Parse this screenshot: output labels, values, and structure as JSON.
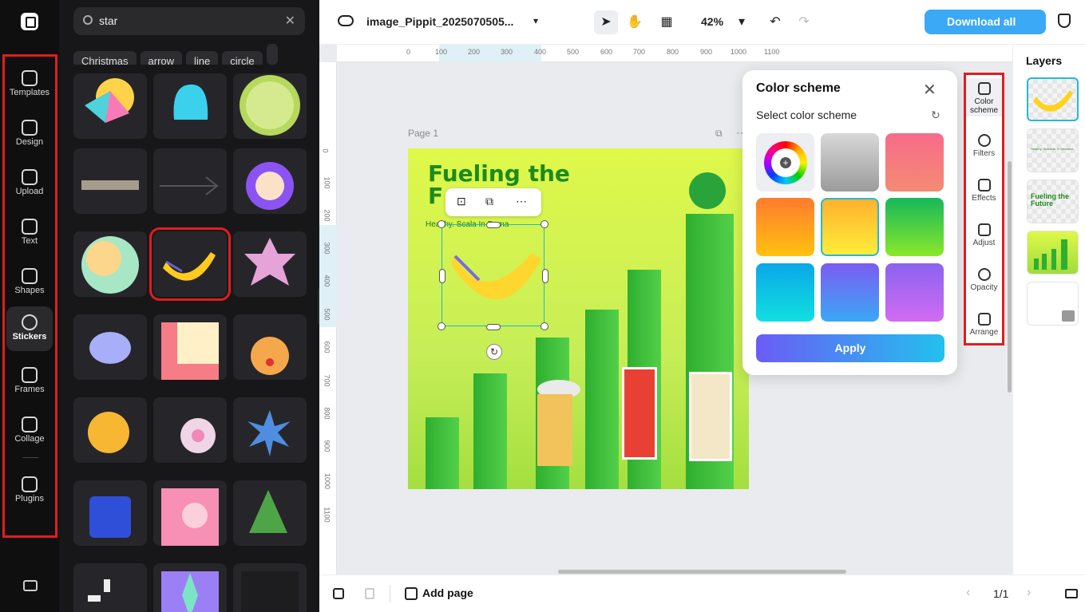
{
  "nav": {
    "items": [
      {
        "label": "Templates",
        "icon": "templates-icon"
      },
      {
        "label": "Design",
        "icon": "design-icon"
      },
      {
        "label": "Upload",
        "icon": "upload-icon"
      },
      {
        "label": "Text",
        "icon": "text-icon"
      },
      {
        "label": "Shapes",
        "icon": "shapes-icon"
      },
      {
        "label": "Stickers",
        "icon": "stickers-icon",
        "active": true
      },
      {
        "label": "Frames",
        "icon": "frames-icon"
      },
      {
        "label": "Collage",
        "icon": "collage-icon"
      },
      {
        "label": "Plugins",
        "icon": "plugins-icon"
      }
    ]
  },
  "search": {
    "value": "star"
  },
  "chips": [
    "Christmas",
    "arrow",
    "line",
    "circle"
  ],
  "topbar": {
    "filename": "image_Pippit_2025070505...",
    "zoom": "42%",
    "download_label": "Download all"
  },
  "ruler": {
    "top": [
      "0",
      "100",
      "200",
      "300",
      "400",
      "500",
      "600",
      "700",
      "800",
      "900",
      "1000",
      "1100"
    ],
    "left": [
      "0",
      "100",
      "200",
      "300",
      "400",
      "500",
      "600",
      "700",
      "800",
      "900",
      "1000",
      "1100"
    ]
  },
  "canvas": {
    "page_label": "Page 1",
    "title_line1": "Fueling the",
    "title_line2": "F",
    "subtitle": "Healthy. Scala In Dema"
  },
  "color_scheme": {
    "title": "Color scheme",
    "subtitle": "Select color scheme",
    "apply_label": "Apply",
    "swatches": [
      {
        "name": "custom",
        "gradient": "wheel"
      },
      {
        "name": "gray",
        "gradient": "linear-gradient(180deg,#d8d8d8,#9b9b9b)"
      },
      {
        "name": "pink",
        "gradient": "linear-gradient(180deg,#f76b8a,#f48b74)"
      },
      {
        "name": "orange",
        "gradient": "linear-gradient(180deg,#ff7b2e,#ffc20f)"
      },
      {
        "name": "yellow",
        "gradient": "linear-gradient(180deg,#ffb02e,#ffee3a)"
      },
      {
        "name": "green",
        "gradient": "linear-gradient(180deg,#16b85a,#8ae82b)"
      },
      {
        "name": "cyan",
        "gradient": "linear-gradient(180deg,#0aa7e8,#12dfe0)"
      },
      {
        "name": "blue",
        "gradient": "linear-gradient(180deg,#7b5cf2,#3aa8f6)"
      },
      {
        "name": "purple",
        "gradient": "linear-gradient(180deg,#8a63f0,#d26bf2)"
      }
    ]
  },
  "right_tools": [
    {
      "label": "Color scheme",
      "icon": "paint-bucket-icon",
      "active": true
    },
    {
      "label": "Filters",
      "icon": "filters-icon"
    },
    {
      "label": "Effects",
      "icon": "effects-icon"
    },
    {
      "label": "Adjust",
      "icon": "adjust-icon"
    },
    {
      "label": "Opacity",
      "icon": "opacity-icon"
    },
    {
      "label": "Arrange",
      "icon": "arrange-icon"
    }
  ],
  "layers": {
    "title": "Layers",
    "thumb_text_1": "Healthy. Scalable. In Demand.",
    "thumb_text_2": "Fueling the Future"
  },
  "bottom": {
    "add_page_label": "Add page",
    "page_counter": "1/1"
  },
  "colors": {
    "accent_red": "#e11d1d",
    "download_blue": "#3ba9f5",
    "selection_cyan": "#1fb8c9"
  }
}
